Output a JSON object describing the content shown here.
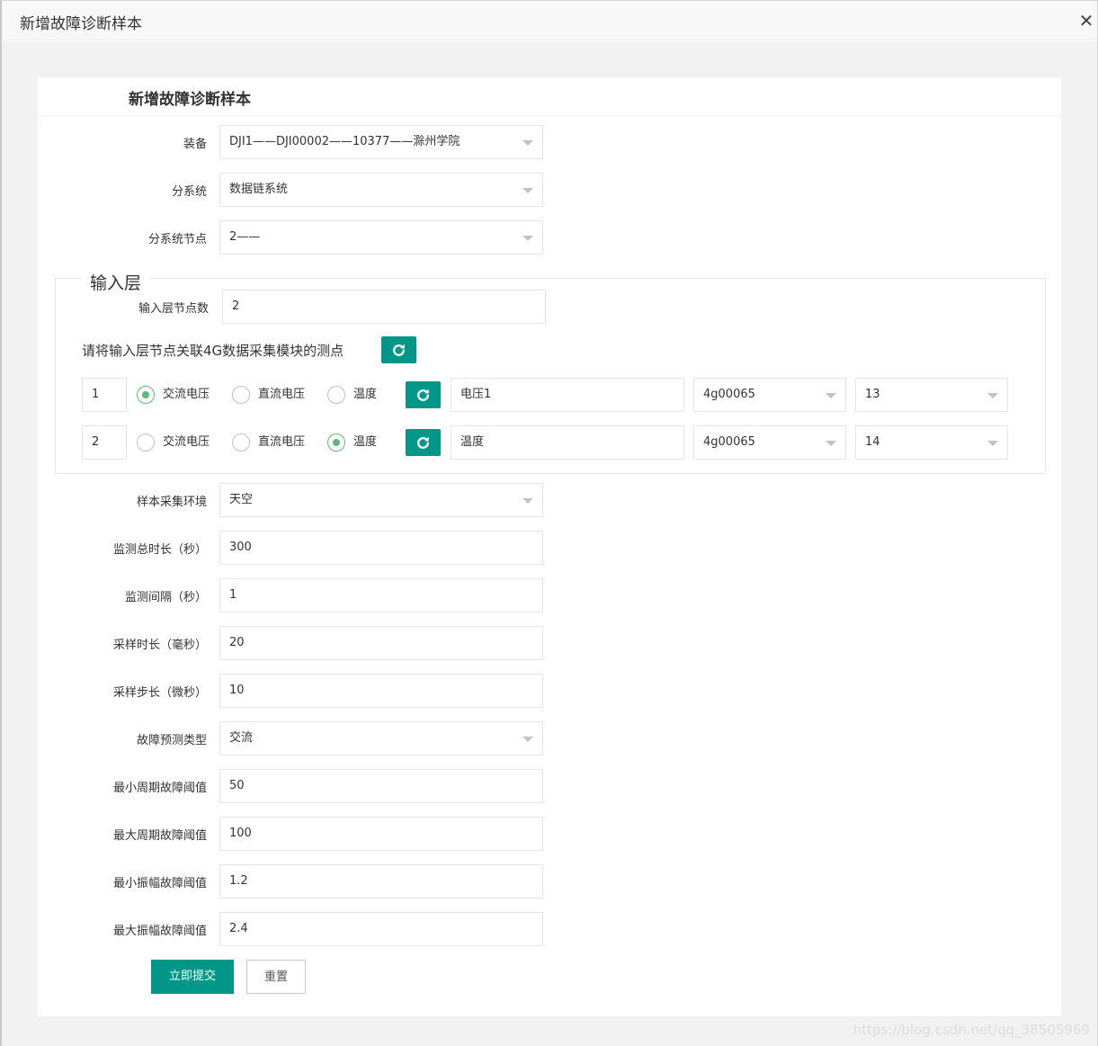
{
  "window": {
    "title": "新增故障诊断样本"
  },
  "form": {
    "heading": "新增故障诊断样本",
    "equipment": {
      "label": "装备",
      "value": "DJI1——DJI00002——10377——滁州学院"
    },
    "subsystem": {
      "label": "分系统",
      "value": "数据链系统"
    },
    "subsystem_node": {
      "label": "分系统节点",
      "value": "2——"
    },
    "input_layer": {
      "legend": "输入层",
      "node_count_label": "输入层节点数",
      "node_count_value": "2",
      "hint": "请将输入层节点关联4G数据采集模块的测点",
      "rows": [
        {
          "index": "1",
          "options": [
            "交流电压",
            "直流电压",
            "温度"
          ],
          "selected": 0,
          "point_name": "电压1",
          "module": "4g00065",
          "channel": "13"
        },
        {
          "index": "2",
          "options": [
            "交流电压",
            "直流电压",
            "温度"
          ],
          "selected": 2,
          "point_name": "温度",
          "module": "4g00065",
          "channel": "14"
        }
      ]
    },
    "environment": {
      "label": "样本采集环境",
      "value": "天空"
    },
    "total_duration": {
      "label": "监测总时长（秒）",
      "value": "300"
    },
    "interval": {
      "label": "监测间隔（秒）",
      "value": "1"
    },
    "sample_duration": {
      "label": "采样时长（毫秒）",
      "value": "20"
    },
    "sample_step": {
      "label": "采样步长（微秒）",
      "value": "10"
    },
    "fault_type": {
      "label": "故障预测类型",
      "value": "交流"
    },
    "min_period": {
      "label": "最小周期故障阈值",
      "value": "50"
    },
    "max_period": {
      "label": "最大周期故障阈值",
      "value": "100"
    },
    "min_amplitude": {
      "label": "最小振幅故障阈值",
      "value": "1.2"
    },
    "max_amplitude": {
      "label": "最大振幅故障阈值",
      "value": "2.4"
    },
    "submit_label": "立即提交",
    "reset_label": "重置"
  },
  "watermark": "https://blog.csdn.net/qq_38505969",
  "colors": {
    "primary": "#009688",
    "radio_checked": "#5FB878",
    "border": "#e6e6e6",
    "background": "#f2f2f2"
  },
  "icons": {
    "refresh": "refresh-icon",
    "close": "close-icon",
    "dropdown": "chevron-down-icon"
  }
}
